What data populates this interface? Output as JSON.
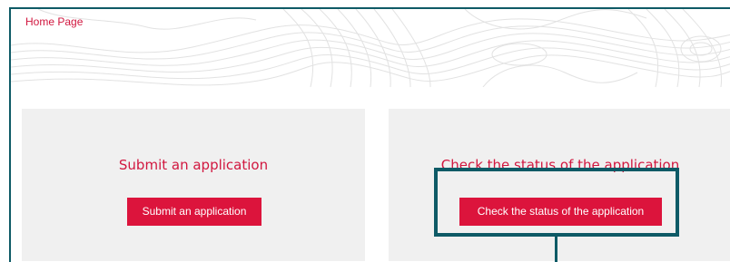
{
  "breadcrumb": {
    "home_label": "Home Page"
  },
  "cards": {
    "submit": {
      "title": "Submit an application",
      "button_label": "Submit an application"
    },
    "status": {
      "title": "Check the status of the application",
      "button_label": "Check the status of the application"
    }
  },
  "colors": {
    "accent": "#dc143c",
    "accent_text": "#d1173f",
    "frame": "#0e5a66",
    "card_background": "#f0f0f0",
    "contour_lines": "#e2e2e2"
  }
}
